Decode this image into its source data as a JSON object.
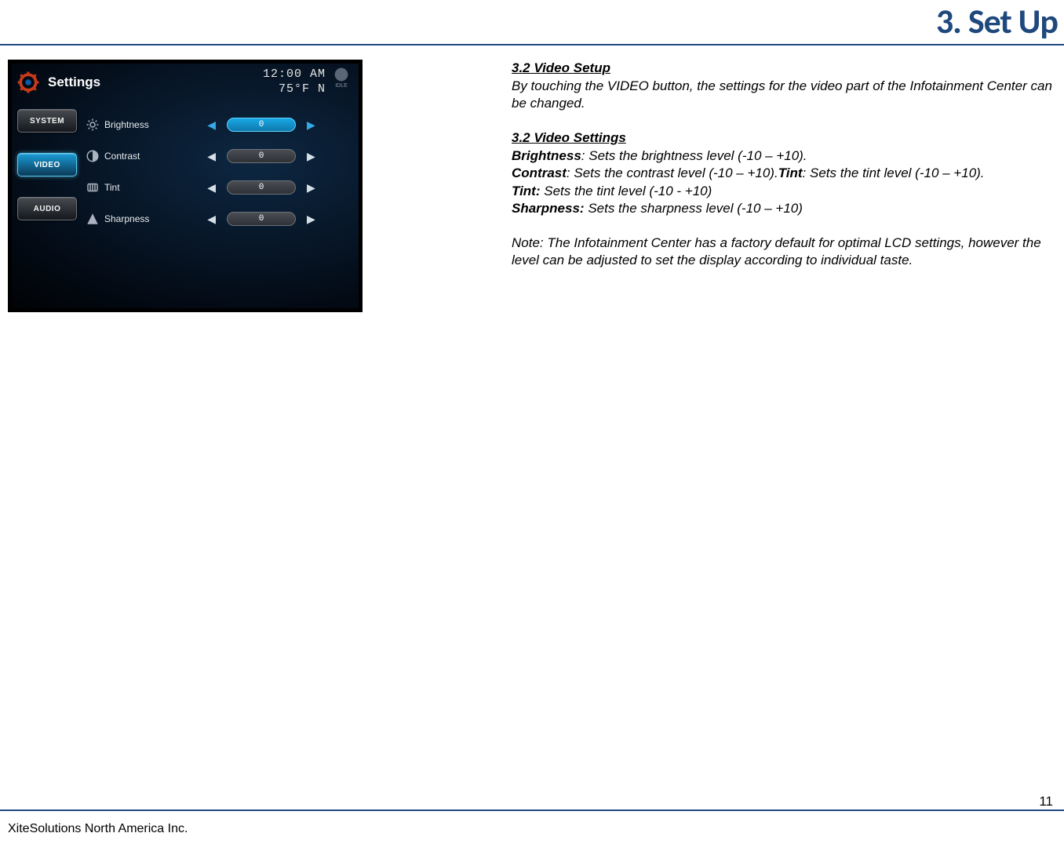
{
  "header": {
    "title": "3. Set Up"
  },
  "device": {
    "title": "Settings",
    "time": "12:00 AM",
    "temp": "75°F  N",
    "idle_label": "IDLE",
    "tabs": [
      {
        "label": "SYSTEM",
        "active": false
      },
      {
        "label": "VIDEO",
        "active": true
      },
      {
        "label": "AUDIO",
        "active": false
      }
    ],
    "rows": [
      {
        "icon": "brightness",
        "label": "Brightness",
        "value": "0",
        "active": true
      },
      {
        "icon": "contrast",
        "label": "Contrast",
        "value": "0",
        "active": false
      },
      {
        "icon": "tint",
        "label": "Tint",
        "value": "0",
        "active": false
      },
      {
        "icon": "sharpness",
        "label": "Sharpness",
        "value": "0",
        "active": false
      }
    ]
  },
  "text": {
    "h1": "3.2  Video Setup",
    "p1": "By touching the VIDEO button, the settings for the video part of the Infotainment Center can be changed.",
    "h2": "3.2 Video Settings",
    "b_brightness": "Brightness",
    "d_brightness": ": Sets the brightness level (-10 – +10).",
    "b_contrast": "Contrast",
    "d_contrast": ": Sets the contrast level (-10 – +10).",
    "b_tint_inline": "Tint",
    "d_tint_inline": ": Sets the tint level (-10 – +10).",
    "b_tint": "Tint:",
    "d_tint": " Sets the tint level (-10 - +10)",
    "b_sharpness": "Sharpness:",
    "d_sharpness": " Sets the sharpness level (-10 – +10)",
    "note": "Note: The Infotainment Center has a factory default for optimal LCD settings, however the level can be adjusted to set the display according to individual taste."
  },
  "footer": {
    "company": "XiteSolutions North America Inc.",
    "page": "11"
  }
}
